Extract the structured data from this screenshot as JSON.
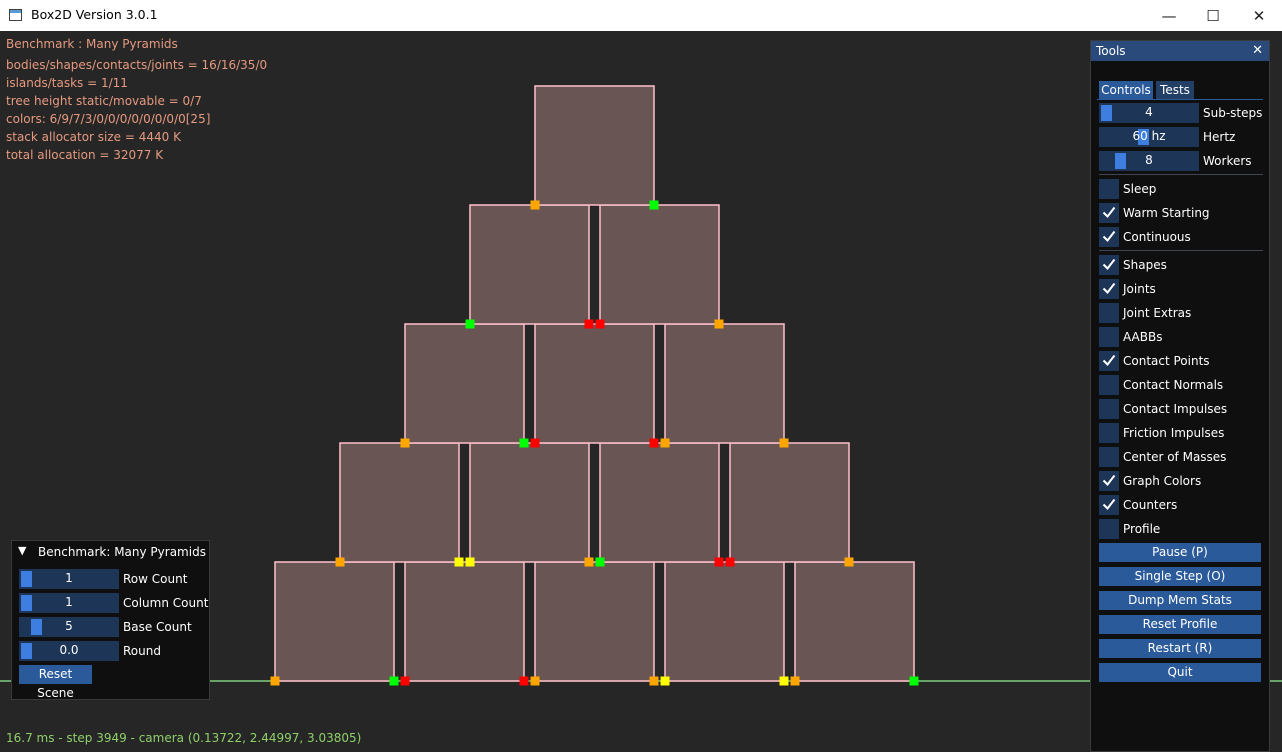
{
  "window": {
    "title": "Box2D Version 3.0.1",
    "minimize_glyph": "—",
    "maximize_glyph": "☐",
    "close_glyph": "✕"
  },
  "info_lines": [
    "Benchmark : Many Pyramids",
    "bodies/shapes/contacts/joints = 16/16/35/0",
    "islands/tasks = 1/11",
    "tree height static/movable = 0/7",
    "colors: 6/9/7/3/0/0/0/0/0/0/0/0[25]",
    "stack allocator size = 4440 K",
    "total allocation = 32077 K"
  ],
  "status": "16.7 ms - step 3949 - camera (0.13722, 2.44997, 3.03805)",
  "tools": {
    "title": "Tools",
    "close_glyph": "✕",
    "tabs": [
      "Controls",
      "Tests"
    ],
    "sliders": [
      {
        "value": "4",
        "label": "Sub-steps",
        "fraction": 0.0
      },
      {
        "value": "60 hz",
        "label": "Hertz",
        "fraction": 0.42
      },
      {
        "value": "8",
        "label": "Workers",
        "fraction": 0.16
      }
    ],
    "options_a": [
      {
        "label": "Sleep",
        "checked": false
      },
      {
        "label": "Warm Starting",
        "checked": true
      },
      {
        "label": "Continuous",
        "checked": true
      }
    ],
    "options_b": [
      {
        "label": "Shapes",
        "checked": true
      },
      {
        "label": "Joints",
        "checked": true
      },
      {
        "label": "Joint Extras",
        "checked": false
      },
      {
        "label": "AABBs",
        "checked": false
      },
      {
        "label": "Contact Points",
        "checked": true
      },
      {
        "label": "Contact Normals",
        "checked": false
      },
      {
        "label": "Contact Impulses",
        "checked": false
      },
      {
        "label": "Friction Impulses",
        "checked": false
      },
      {
        "label": "Center of Masses",
        "checked": false
      },
      {
        "label": "Graph Colors",
        "checked": true
      },
      {
        "label": "Counters",
        "checked": true
      },
      {
        "label": "Profile",
        "checked": false
      }
    ],
    "buttons": [
      "Pause (P)",
      "Single Step (O)",
      "Dump Mem Stats",
      "Reset Profile",
      "Restart (R)",
      "Quit"
    ]
  },
  "bench": {
    "title": "Benchmark: Many Pyramids",
    "collapse_glyph": "▼",
    "sliders": [
      {
        "value": "1",
        "label": "Row Count",
        "fraction": 0.0
      },
      {
        "value": "1",
        "label": "Column Count",
        "fraction": 0.0
      },
      {
        "value": "5",
        "label": "Base Count",
        "fraction": 0.12
      },
      {
        "value": "0.0",
        "label": "Round",
        "fraction": 0.0
      }
    ],
    "button": "Reset Scene"
  },
  "scene": {
    "base_count": 5,
    "box_fill": "#6a5555",
    "box_outline": "#ffc0cb",
    "ground_color": "#90ee90",
    "contact_colors": {
      "red": "#ff0000",
      "orange": "#ffa500",
      "yellow": "#ffff00",
      "green": "#00ff00"
    }
  }
}
